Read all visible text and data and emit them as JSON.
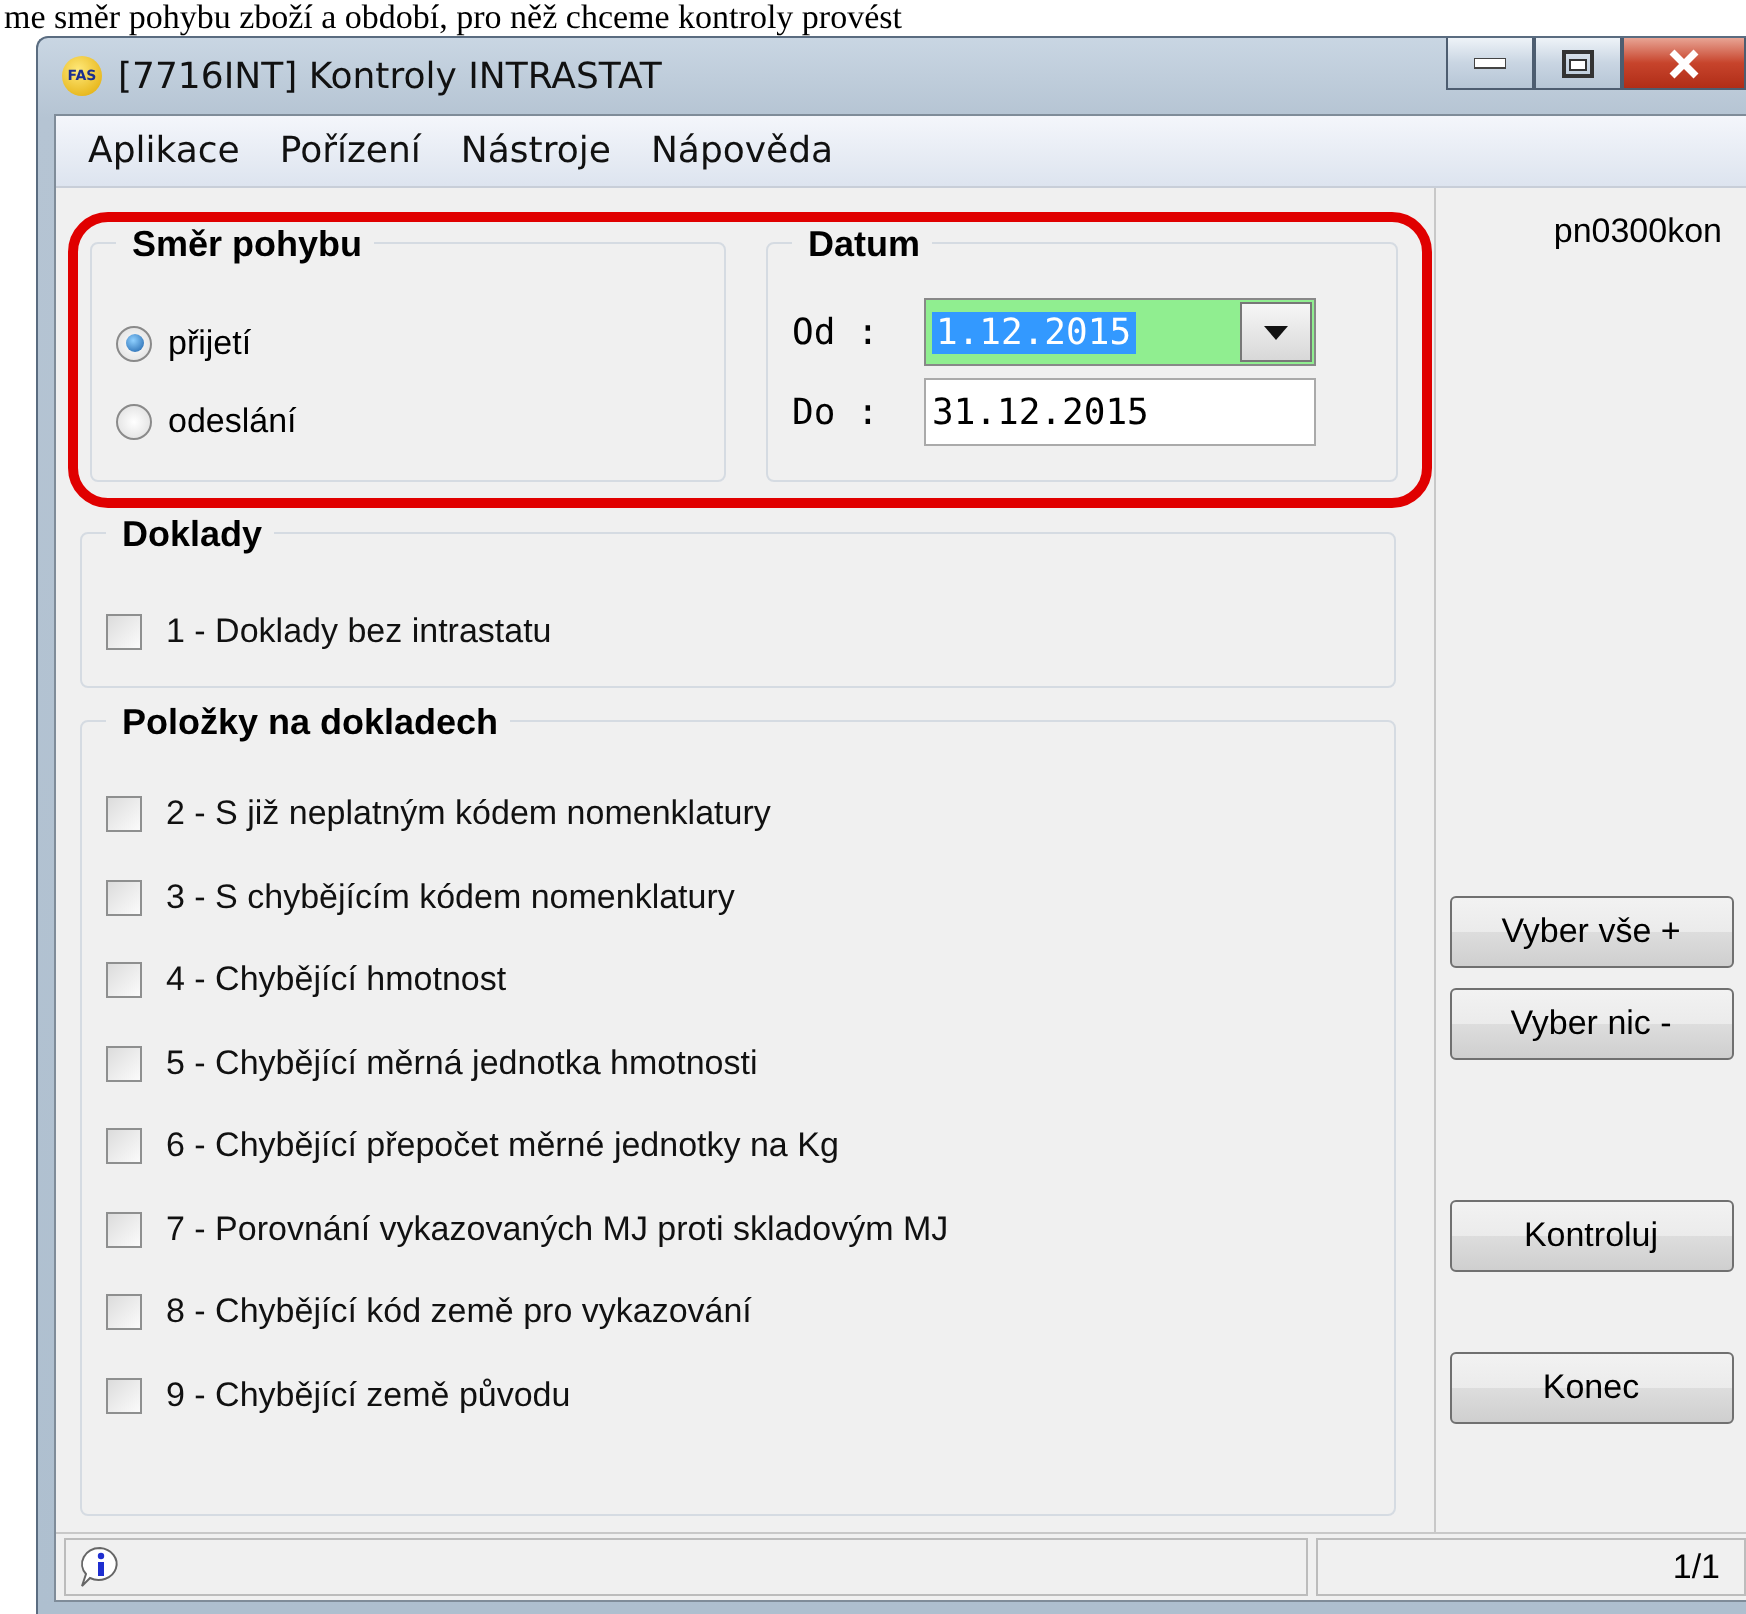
{
  "caption": "me směr pohybu zboží a období, pro něž chceme kontroly provést",
  "window": {
    "logo": "FAS",
    "title": "[7716INT] Kontroly INTRASTAT"
  },
  "menu": [
    "Aplikace",
    "Pořízení",
    "Nástroje",
    "Nápověda"
  ],
  "direction": {
    "title": "Směr pohybu",
    "options": [
      {
        "label": "přijetí",
        "selected": true
      },
      {
        "label": "odeslání",
        "selected": false
      }
    ]
  },
  "date": {
    "title": "Datum",
    "from_label": "Od :",
    "from_value": "1.12.2015",
    "to_label": "Do :",
    "to_value": "31.12.2015"
  },
  "documents": {
    "title": "Doklady",
    "items": [
      {
        "label": "1 - Doklady bez intrastatu",
        "checked": false
      }
    ]
  },
  "items": {
    "title": "Položky na dokladech",
    "items": [
      {
        "label": "2 - S již neplatným kódem nomenklatury",
        "checked": false
      },
      {
        "label": "3 - S chybějícím kódem nomenklatury",
        "checked": false
      },
      {
        "label": "4 - Chybějící hmotnost",
        "checked": false
      },
      {
        "label": "5 - Chybějící měrná jednotka hmotnosti",
        "checked": false
      },
      {
        "label": "6 - Chybějící přepočet měrné jednotky na Kg",
        "checked": false
      },
      {
        "label": "7 - Porovnání vykazovaných MJ proti skladovým MJ",
        "checked": false
      },
      {
        "label": "8 - Chybějící kód země pro vykazování",
        "checked": false
      },
      {
        "label": "9 - Chybějící země původu",
        "checked": false
      }
    ]
  },
  "form_code": "pn0300kon",
  "buttons": [
    "Vyber vše +",
    "Vyber nic -",
    "Kontroluj",
    "Konec"
  ],
  "status_bar": {
    "page": "1/1"
  }
}
